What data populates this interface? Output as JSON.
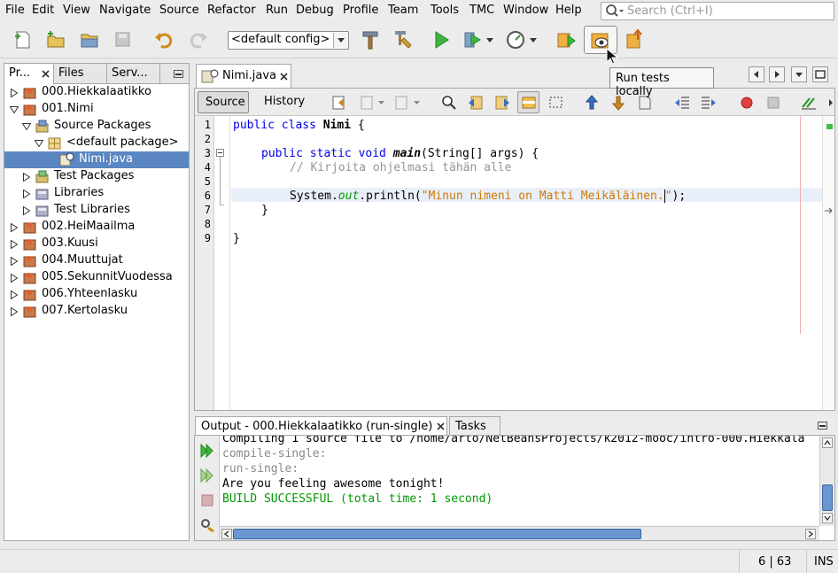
{
  "menu": [
    "File",
    "Edit",
    "View",
    "Navigate",
    "Source",
    "Refactor",
    "Run",
    "Debug",
    "Profile",
    "Team",
    "Tools",
    "TMC",
    "Window",
    "Help"
  ],
  "search": {
    "placeholder": "Search (Ctrl+I)"
  },
  "toolbar": {
    "config": "<default config>",
    "tooltip": "Run tests locally"
  },
  "project_tabs": [
    "Pr...",
    "Files",
    "Serv..."
  ],
  "tree": [
    {
      "label": "000.Hiekkalaatikko",
      "level": 0,
      "state": "collapsed",
      "icon": "project-icon"
    },
    {
      "label": "001.Nimi",
      "level": 0,
      "state": "expanded",
      "icon": "project-icon"
    },
    {
      "label": "Source Packages",
      "level": 1,
      "state": "expanded",
      "icon": "source-packages-icon"
    },
    {
      "label": "<default package>",
      "level": 2,
      "state": "expanded",
      "icon": "package-icon"
    },
    {
      "label": "Nimi.java",
      "level": 3,
      "state": "leaf",
      "icon": "java-file-icon",
      "selected": true
    },
    {
      "label": "Test Packages",
      "level": 1,
      "state": "collapsed",
      "icon": "test-packages-icon"
    },
    {
      "label": "Libraries",
      "level": 1,
      "state": "collapsed",
      "icon": "libraries-icon"
    },
    {
      "label": "Test Libraries",
      "level": 1,
      "state": "collapsed",
      "icon": "libraries-icon"
    },
    {
      "label": "002.HeiMaailma",
      "level": 0,
      "state": "collapsed",
      "icon": "project-icon"
    },
    {
      "label": "003.Kuusi",
      "level": 0,
      "state": "collapsed",
      "icon": "project-icon"
    },
    {
      "label": "004.Muuttujat",
      "level": 0,
      "state": "collapsed",
      "icon": "project-icon"
    },
    {
      "label": "005.SekunnitVuodessa",
      "level": 0,
      "state": "collapsed",
      "icon": "project-icon"
    },
    {
      "label": "006.Yhteenlasku",
      "level": 0,
      "state": "collapsed",
      "icon": "project-icon"
    },
    {
      "label": "007.Kertolasku",
      "level": 0,
      "state": "collapsed",
      "icon": "project-icon"
    }
  ],
  "editor": {
    "file_tab": "Nimi.java",
    "source_label": "Source",
    "history_label": "History",
    "code": {
      "l1_a": "public class ",
      "l1_b": "Nimi",
      "l1_c": " {",
      "l3_a": "public static void ",
      "l3_b": "main",
      "l3_c": "(String[] args) {",
      "l4": "// Kirjoita ohjelmasi tähän alle",
      "l6_a": "System.",
      "l6_b": "out",
      "l6_c": ".println(",
      "l6_d": "\"Minun nimeni on Matti Meikäläinen.",
      "l6_e": "\"",
      "l6_f": ");",
      "l7": "}",
      "l9": "}"
    },
    "line_numbers": [
      "1",
      "2",
      "3",
      "4",
      "5",
      "6",
      "7",
      "8",
      "9"
    ]
  },
  "output": {
    "tab_label": "Output - 000.Hiekkalaatikko (run-single)",
    "tasks_label": "Tasks",
    "lines": [
      "Compiling 1 source file to /home/arto/NetBeansProjects/k2012-mooc/intro-000.Hiekkala",
      "compile-single:",
      "run-single:",
      "Are you feeling awesome tonight!",
      "BUILD SUCCESSFUL (total time: 1 second)"
    ]
  },
  "status": {
    "position": "6 | 63",
    "mode": "INS"
  },
  "colors": {
    "keyword": "#0000e6",
    "string": "#ce7b00",
    "comment": "#969696",
    "field": "#009900",
    "build_success": "#009900",
    "selection": "#5a86c2"
  }
}
